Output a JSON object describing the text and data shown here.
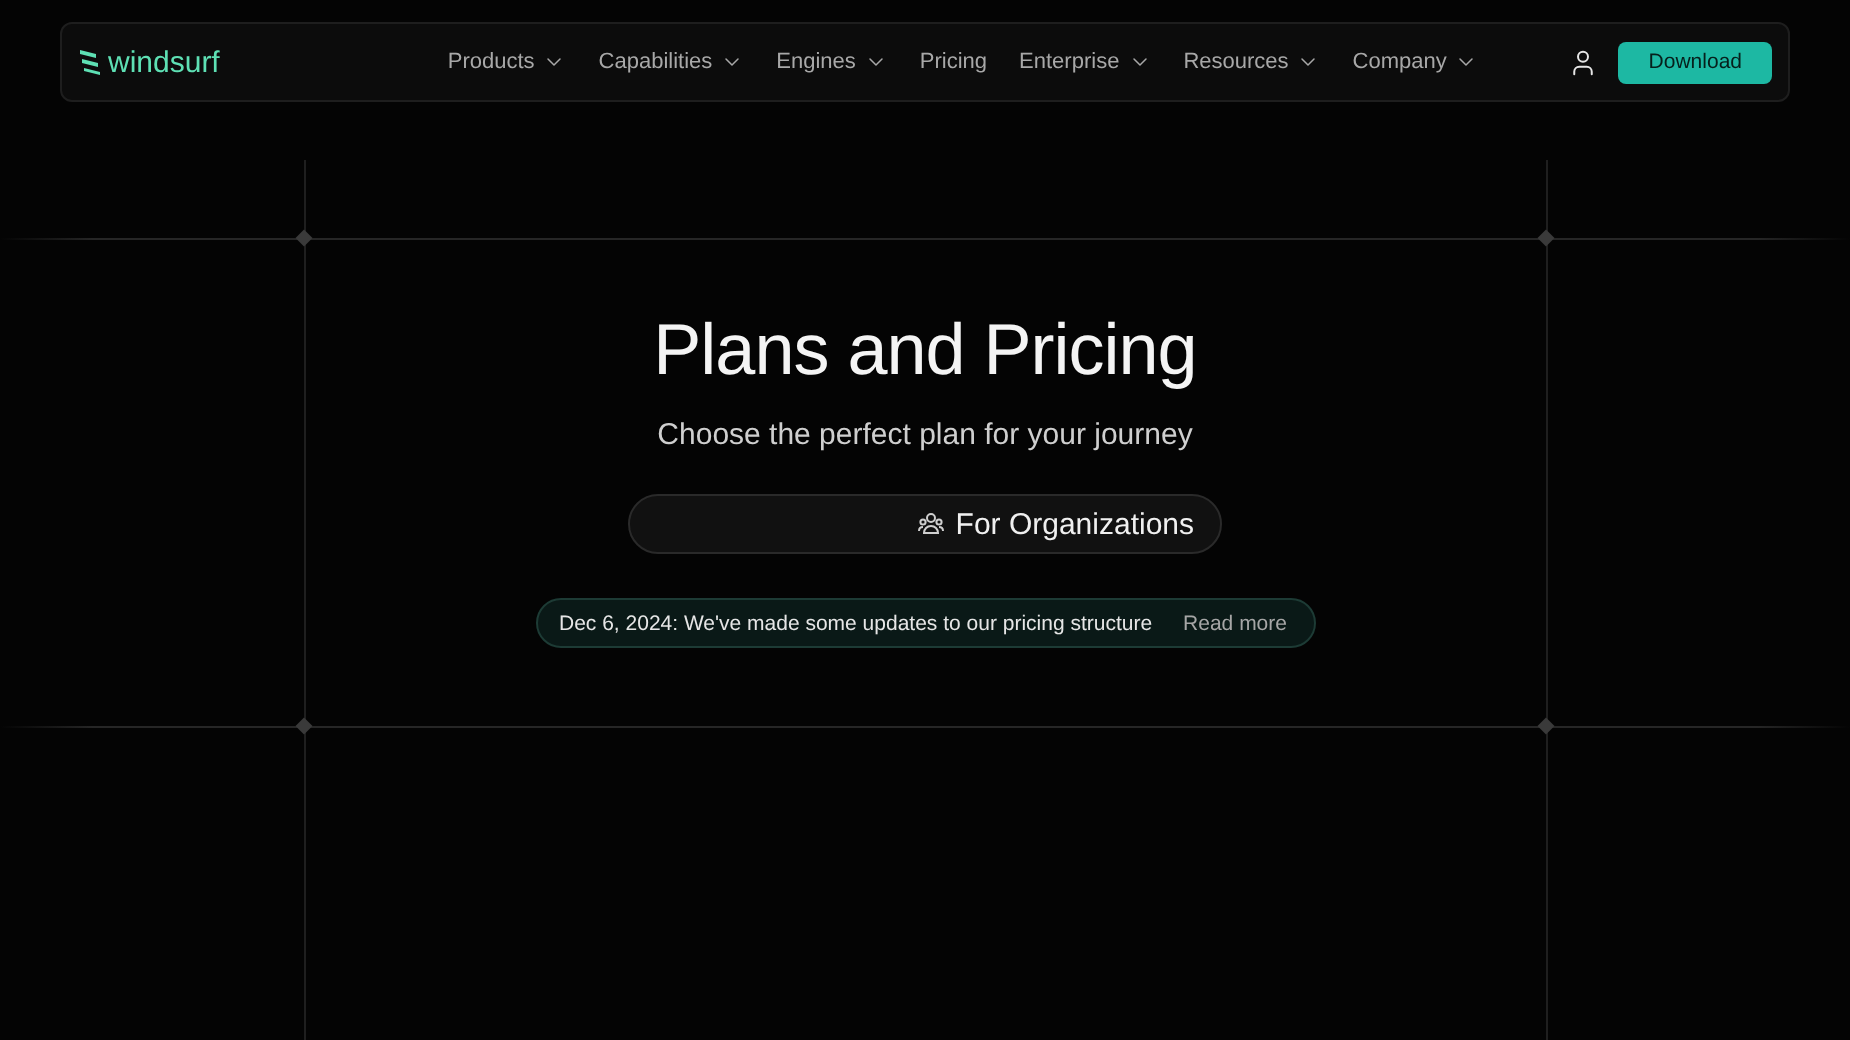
{
  "nav": {
    "logo": "windsurf",
    "items": [
      {
        "label": "Products",
        "dropdown": true
      },
      {
        "label": "Capabilities",
        "dropdown": true
      },
      {
        "label": "Engines",
        "dropdown": true
      },
      {
        "label": "Pricing",
        "dropdown": false
      },
      {
        "label": "Enterprise",
        "dropdown": true
      },
      {
        "label": "Resources",
        "dropdown": true
      },
      {
        "label": "Company",
        "dropdown": true
      }
    ],
    "download_button": "Download"
  },
  "hero": {
    "title": "Plans and Pricing",
    "subtitle": "Choose the perfect plan for your journey",
    "plan_toggle": {
      "options": [
        {
          "label": "For Organizations",
          "selected": true
        }
      ]
    },
    "notice": {
      "text": "Dec 6, 2024: We've made some updates to our pricing structure",
      "link": "Read more"
    }
  }
}
